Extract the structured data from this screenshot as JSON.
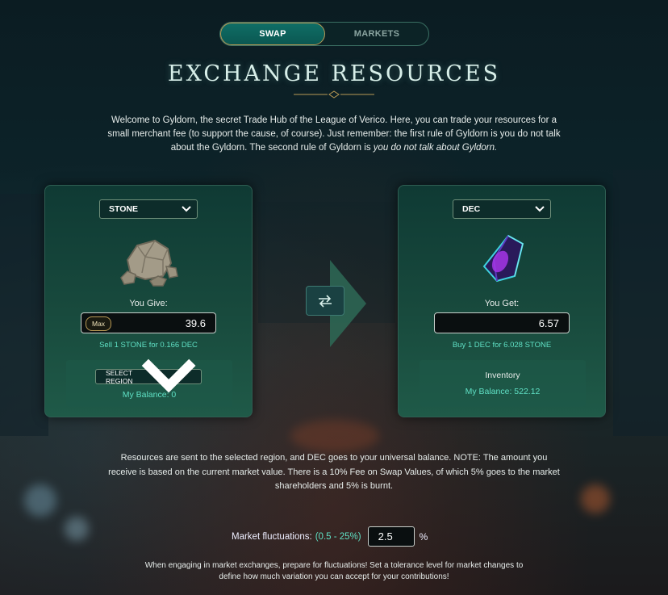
{
  "tabs": [
    {
      "label": "SWAP",
      "active": true
    },
    {
      "label": "MARKETS",
      "active": false
    }
  ],
  "title": "EXCHANGE RESOURCES",
  "intro": {
    "text": "Welcome to Gyldorn, the secret Trade Hub of the League of Verico. Here, you can trade your resources for a small merchant fee (to support the cause, of course). Just remember: the first rule of Gyldorn is you do not talk about the Gyldorn. The second rule of Gyldorn is ",
    "emphasis": "you do not talk about Gyldorn."
  },
  "give": {
    "resource": "STONE",
    "label": "You Give:",
    "max_label": "Max",
    "amount": "39.6",
    "rate": "Sell 1 STONE for 0.166 DEC",
    "region_select": "SELECT REGION",
    "balance": "My Balance: 0",
    "icon": "stone-icon"
  },
  "get": {
    "resource": "DEC",
    "label": "You Get:",
    "amount": "6.57",
    "rate": "Buy 1 DEC for 6.028 STONE",
    "inventory_label": "Inventory",
    "balance": "My Balance: 522.12",
    "icon": "dec-crystal-icon"
  },
  "note": "Resources are sent to the selected region, and DEC goes to your universal balance. NOTE: The amount you receive is based on the current market value. There is a 10% Fee on Swap Values, of which 5% goes to the market shareholders and 5% is burnt.",
  "fluctuation": {
    "label": "Market fluctuations:",
    "range": "(0.5 - 25%)",
    "value": "2.5",
    "unit": "%"
  },
  "warning": "When engaging in market exchanges, prepare for fluctuations! Set a tolerance level for market changes to define how much variation you can accept for your contributions!",
  "colors": {
    "accent_teal": "#5fe0c4",
    "tab_active": "#0f6e66",
    "gold_border": "#b99a55",
    "card_bg": "#184a3d"
  }
}
